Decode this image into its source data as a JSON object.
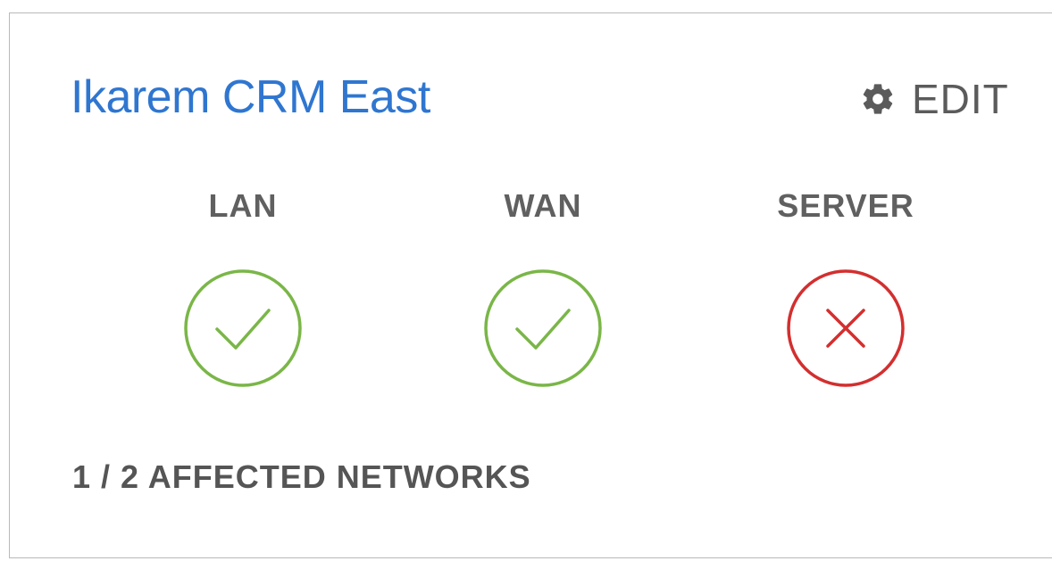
{
  "card": {
    "title": "Ikarem CRM East",
    "edit_label": "EDIT",
    "edit_icon": "gear-icon",
    "statuses": [
      {
        "label": "LAN",
        "state": "ok",
        "icon": "check-circle-icon",
        "color": "#7ab648"
      },
      {
        "label": "WAN",
        "state": "ok",
        "icon": "check-circle-icon",
        "color": "#7ab648"
      },
      {
        "label": "SERVER",
        "state": "error",
        "icon": "x-circle-icon",
        "color": "#d32f2f"
      }
    ],
    "affected_text": "1 / 2 AFFECTED NETWORKS"
  },
  "colors": {
    "title": "#2f76d0",
    "text": "#555555",
    "ok": "#7ab648",
    "error": "#d32f2f"
  }
}
